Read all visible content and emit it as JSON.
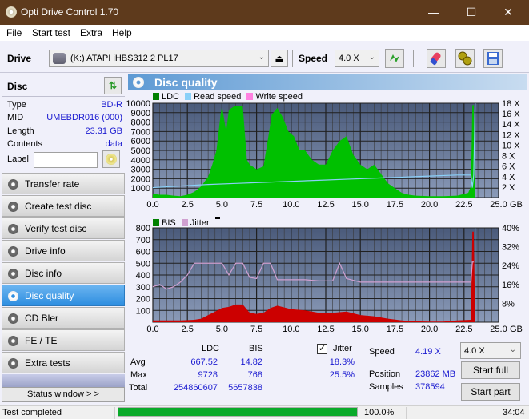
{
  "window": {
    "title": "Opti Drive Control 1.70",
    "minimize": "—",
    "maximize": "☐",
    "close": "✕"
  },
  "menu": [
    "File",
    "Start test",
    "Extra",
    "Help"
  ],
  "toolbar": {
    "drive_label": "Drive",
    "drive_value": "(K:)  ATAPI iHBS312  2 PL17",
    "speed_label": "Speed",
    "speed_value": "4.0 X"
  },
  "disc": {
    "header": "Disc",
    "fields": [
      {
        "key": "Type",
        "value": "BD-R"
      },
      {
        "key": "MID",
        "value": "UMEBDR016 (000)"
      },
      {
        "key": "Length",
        "value": "23.31 GB"
      },
      {
        "key": "Contents",
        "value": "data"
      }
    ],
    "label_key": "Label",
    "label_value": ""
  },
  "nav": [
    {
      "label": "Transfer rate",
      "active": false
    },
    {
      "label": "Create test disc",
      "active": false
    },
    {
      "label": "Verify test disc",
      "active": false
    },
    {
      "label": "Drive info",
      "active": false
    },
    {
      "label": "Disc info",
      "active": false
    },
    {
      "label": "Disc quality",
      "active": true
    },
    {
      "label": "CD Bler",
      "active": false
    },
    {
      "label": "FE / TE",
      "active": false
    },
    {
      "label": "Extra tests",
      "active": false
    }
  ],
  "status_window_button": "Status window > >",
  "panel_title": "Disc quality",
  "colors": {
    "ldc": "#008000",
    "read_speed": "#8ad0f8",
    "write_speed": "#ff80e0",
    "bis": "#008000",
    "jitter": "#d0a0d0",
    "ldc_fill": "#00c000",
    "bis_fill": "#cc0000",
    "plot_bg_top": "#4a5a7a",
    "plot_bg_bottom": "#8a9ab8"
  },
  "chart_data": [
    {
      "type": "area",
      "title": "LDC / Read speed",
      "legend": [
        "LDC",
        "Read speed",
        "Write speed"
      ],
      "xlabel": "GB",
      "x_ticks": [
        "0.0",
        "2.5",
        "5.0",
        "7.5",
        "10.0",
        "12.5",
        "15.0",
        "17.5",
        "20.0",
        "22.5",
        "25.0"
      ],
      "y_ticks_left": [
        "1000",
        "2000",
        "3000",
        "4000",
        "5000",
        "6000",
        "7000",
        "8000",
        "9000",
        "10000"
      ],
      "y_ticks_right": [
        "2 X",
        "4 X",
        "6 X",
        "8 X",
        "10 X",
        "12 X",
        "14 X",
        "16 X",
        "18 X"
      ],
      "xlim": [
        0,
        25
      ],
      "ylim_left": [
        0,
        10000
      ],
      "ylim_right": [
        0,
        18
      ],
      "series": [
        {
          "name": "LDC",
          "x": [
            0,
            0.5,
            1,
            1.5,
            2,
            2.5,
            3,
            3.5,
            4,
            4.3,
            4.6,
            4.9,
            5.0,
            5.3,
            5.5,
            5.8,
            6.0,
            6.5,
            6.8,
            7.0,
            7.5,
            8.0,
            8.3,
            8.6,
            9.0,
            9.4,
            9.8,
            10.2,
            10.6,
            11.0,
            11.5,
            12.0,
            12.5,
            13.0,
            13.5,
            14.0,
            14.5,
            15.0,
            15.5,
            16.0,
            16.5,
            17.0,
            17.5,
            18.0,
            18.5,
            19.0,
            20.0,
            21.0,
            22.0,
            22.8,
            23.0,
            23.1,
            23.2,
            23.3
          ],
          "values": [
            400,
            300,
            300,
            200,
            150,
            300,
            600,
            1200,
            2200,
            3500,
            5000,
            8800,
            9700,
            7000,
            9300,
            9600,
            9700,
            9700,
            4000,
            3500,
            3000,
            3300,
            6000,
            8800,
            9500,
            8500,
            7000,
            6500,
            5000,
            5000,
            4000,
            3500,
            3500,
            5000,
            6000,
            6500,
            4500,
            3500,
            3000,
            3500,
            2500,
            1500,
            1000,
            500,
            300,
            200,
            150,
            150,
            200,
            500,
            1200,
            9800,
            9800,
            0
          ]
        },
        {
          "name": "Read speed",
          "x": [
            0,
            2,
            4,
            6,
            8,
            10,
            12,
            14,
            16,
            18,
            20,
            22,
            23.0,
            23.1,
            23.2,
            23.3
          ],
          "values": [
            1.9,
            2.2,
            2.5,
            2.7,
            2.9,
            3.1,
            3.3,
            3.5,
            3.7,
            3.9,
            4.1,
            4.3,
            4.3,
            1.9,
            4.3,
            18
          ]
        }
      ]
    },
    {
      "type": "area",
      "title": "BIS / Jitter",
      "legend": [
        "BIS",
        "Jitter"
      ],
      "xlabel": "GB",
      "x_ticks": [
        "0.0",
        "2.5",
        "5.0",
        "7.5",
        "10.0",
        "12.5",
        "15.0",
        "17.5",
        "20.0",
        "22.5",
        "25.0"
      ],
      "y_ticks_left": [
        "100",
        "200",
        "300",
        "400",
        "500",
        "600",
        "700",
        "800"
      ],
      "y_ticks_right": [
        "8%",
        "16%",
        "24%",
        "32%",
        "40%"
      ],
      "xlim": [
        0,
        25
      ],
      "ylim_left": [
        0,
        800
      ],
      "ylim_right": [
        0,
        40
      ],
      "series": [
        {
          "name": "BIS",
          "x": [
            0,
            1,
            2,
            3,
            3.5,
            4,
            4.5,
            5,
            5.5,
            6,
            6.5,
            7,
            7.5,
            8,
            8.5,
            9,
            10,
            11,
            12,
            13,
            14,
            15,
            16,
            17,
            18,
            19,
            20,
            21,
            22,
            23.0,
            23.1,
            23.2,
            23.3
          ],
          "values": [
            15,
            15,
            15,
            20,
            30,
            60,
            90,
            120,
            130,
            150,
            150,
            80,
            70,
            80,
            120,
            140,
            110,
            100,
            80,
            80,
            90,
            60,
            50,
            30,
            15,
            8,
            5,
            5,
            15,
            20,
            768,
            768,
            50
          ]
        },
        {
          "name": "Jitter",
          "x": [
            0,
            0.5,
            1,
            1.5,
            2,
            2.5,
            3,
            3.5,
            4,
            4.5,
            5,
            5.5,
            6,
            6.5,
            7,
            7.5,
            8,
            8.5,
            9,
            10,
            11,
            12,
            13,
            13.5,
            14,
            15,
            17,
            19,
            21,
            22.5,
            23.0,
            23.1,
            23.2
          ],
          "values": [
            15,
            16,
            14,
            15,
            17,
            20,
            25,
            25,
            25,
            25,
            25,
            20,
            25,
            25,
            19,
            18.5,
            25,
            25,
            18,
            18,
            18,
            17.5,
            17.5,
            25,
            18.5,
            17,
            17,
            17,
            17,
            17,
            17,
            25.5,
            25.5
          ]
        }
      ]
    }
  ],
  "stats": {
    "col_ldc": "LDC",
    "col_bis": "BIS",
    "col_jitter": "Jitter",
    "rows": [
      {
        "label": "Avg",
        "ldc": "667.52",
        "bis": "14.82",
        "jitter": "18.3%"
      },
      {
        "label": "Max",
        "ldc": "9728",
        "bis": "768",
        "jitter": "25.5%"
      },
      {
        "label": "Total",
        "ldc": "254860607",
        "bis": "5657838",
        "jitter": ""
      }
    ],
    "jitter_checked": true,
    "speed_label": "Speed",
    "speed_value": "4.19 X",
    "position_label": "Position",
    "position_value": "23862 MB",
    "samples_label": "Samples",
    "samples_value": "378594",
    "speed_select": "4.0 X",
    "start_full": "Start full",
    "start_part": "Start part"
  },
  "statusbar": {
    "text": "Test completed",
    "progress": 100.0,
    "percent": "100.0%",
    "time": "34:04"
  }
}
